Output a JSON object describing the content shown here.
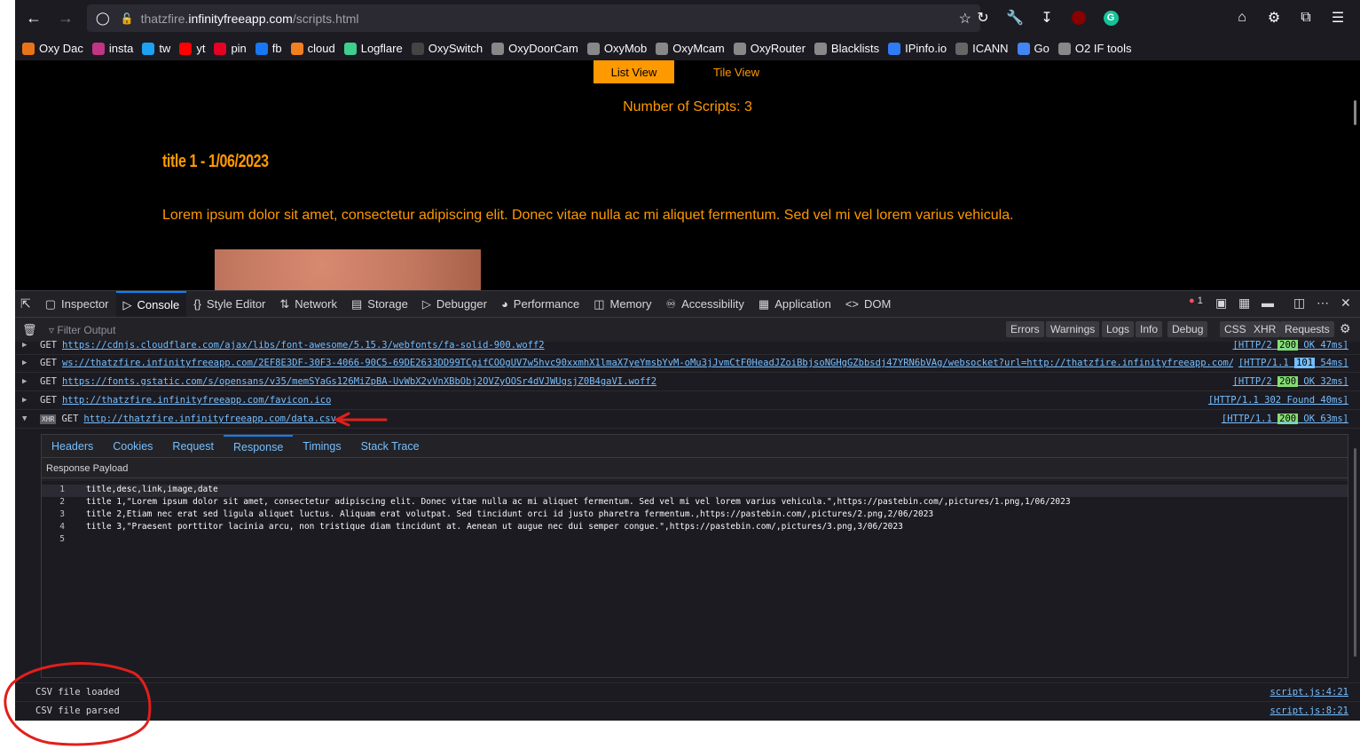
{
  "browser": {
    "url_host": "thatzfire.infinityfreeapp.com",
    "url_path": "/scripts.html",
    "url_prefix": "thatzfire.",
    "url_domain": "infinityfreeapp.com"
  },
  "bookmarks": [
    {
      "label": "Oxy Dac",
      "color": "#e8741a"
    },
    {
      "label": "insta",
      "color": "#c13584"
    },
    {
      "label": "tw",
      "color": "#1da1f2"
    },
    {
      "label": "yt",
      "color": "#ff0000"
    },
    {
      "label": "pin",
      "color": "#e60023"
    },
    {
      "label": "fb",
      "color": "#1877f2"
    },
    {
      "label": "cloud",
      "color": "#f38020"
    },
    {
      "label": "Logflare",
      "color": "#3ecf8e"
    },
    {
      "label": "OxySwitch",
      "color": "#444"
    },
    {
      "label": "OxyDoorCam",
      "color": "#888"
    },
    {
      "label": "OxyMob",
      "color": "#888"
    },
    {
      "label": "OxyMcam",
      "color": "#888"
    },
    {
      "label": "OxyRouter",
      "color": "#888"
    },
    {
      "label": "Blacklists",
      "color": "#888"
    },
    {
      "label": "IPinfo.io",
      "color": "#2e7cf6"
    },
    {
      "label": "ICANN",
      "color": "#666"
    },
    {
      "label": "Go",
      "color": "#4285f4"
    },
    {
      "label": "O2 IF tools",
      "color": "#888"
    }
  ],
  "page": {
    "list_view": "List View",
    "tile_view": "Tile View",
    "num_scripts": "Number of Scripts: 3",
    "item_title": "title 1 - 1/06/2023",
    "item_desc": "Lorem ipsum dolor sit amet, consectetur adipiscing elit. Donec vitae nulla ac mi aliquet fermentum. Sed vel mi vel lorem varius vehicula."
  },
  "devtools": {
    "tabs": [
      "Inspector",
      "Console",
      "Style Editor",
      "Network",
      "Storage",
      "Debugger",
      "Performance",
      "Memory",
      "Accessibility",
      "Application",
      "DOM"
    ],
    "active_tab": "Console",
    "error_count": "1",
    "filter_placeholder": "Filter Output",
    "filters": [
      "Errors",
      "Warnings",
      "Logs",
      "Info",
      "Debug",
      "CSS",
      "XHR",
      "Requests"
    ]
  },
  "requests": [
    {
      "method": "GET",
      "url": "https://cdnjs.cloudflare.com/ajax/libs/font-awesome/5.15.3/webfonts/fa-solid-900.woff2",
      "proto": "[HTTP/2",
      "code": "200",
      "rest": "OK 47ms]"
    },
    {
      "method": "GET",
      "url": "ws://thatzfire.infinityfreeapp.com/2EF8E3DF-30F3-4066-90C5-69DE2633DD99TCgifCOOgUV7w5hvc90xxmhX1lmaX7yeYmsbYvM-oMu3jJvmCtF0HeadJZoiBbjsoNGHgGZbbsdj47YRN6bVAg/websocket?url=http://thatzfire.infinityfreeapp.com/scripts.ht…",
      "proto": "[HTTP/1.1",
      "code": "101",
      "rest": "54ms]"
    },
    {
      "method": "GET",
      "url": "https://fonts.gstatic.com/s/opensans/v35/memSYaGs126MiZpBA-UvWbX2vVnXBbObj2OVZyOOSr4dVJWUgsjZ0B4gaVI.woff2",
      "proto": "[HTTP/2",
      "code": "200",
      "rest": "OK 32ms]"
    },
    {
      "method": "GET",
      "url": "http://thatzfire.infinityfreeapp.com/favicon.ico",
      "proto": "[HTTP/1.1",
      "code": "302",
      "rest": "Found 40ms]"
    },
    {
      "method": "GET",
      "url": "http://thatzfire.infinityfreeapp.com/data.csv",
      "proto": "[HTTP/1.1",
      "code": "200",
      "rest": "OK 63ms]",
      "badge": "XHR"
    }
  ],
  "response": {
    "tabs": [
      "Headers",
      "Cookies",
      "Request",
      "Response",
      "Timings",
      "Stack Trace"
    ],
    "active_tab": "Response",
    "payload_label": "Response Payload",
    "lines": [
      "title,desc,link,image,date",
      "title 1,\"Lorem ipsum dolor sit amet, consectetur adipiscing elit. Donec vitae nulla ac mi aliquet fermentum. Sed vel mi vel lorem varius vehicula.\",https://pastebin.com/,pictures/1.png,1/06/2023",
      "title 2,Etiam nec erat sed ligula aliquet luctus. Aliquam erat volutpat. Sed tincidunt orci id justo pharetra fermentum.,https://pastebin.com/,pictures/2.png,2/06/2023",
      "title 3,\"Praesent porttitor lacinia arcu, non tristique diam tincidunt at. Aenean ut augue nec dui semper congue.\",https://pastebin.com/,pictures/3.png,3/06/2023",
      ""
    ]
  },
  "messages": [
    {
      "text": "CSV file loaded",
      "src": "script.js:4:21"
    },
    {
      "text": "CSV file parsed",
      "src": "script.js:8:21"
    }
  ],
  "annotation_color": "#e0201b"
}
